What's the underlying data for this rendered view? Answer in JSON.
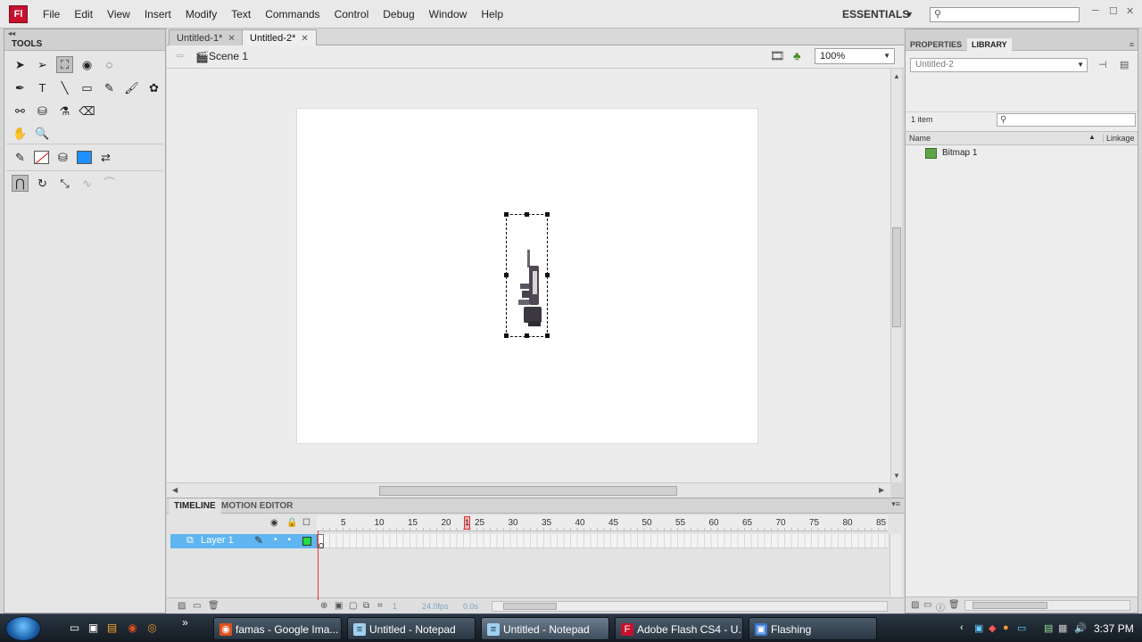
{
  "app": {
    "logo": "Fl",
    "menus": [
      "File",
      "Edit",
      "View",
      "Insert",
      "Modify",
      "Text",
      "Commands",
      "Control",
      "Debug",
      "Window",
      "Help"
    ],
    "workspace": "ESSENTIALS",
    "colors": {
      "logo_red": "#c8102e",
      "layer_blue": "#5fb5f0",
      "playhead_red": "#e33333",
      "fill_color": "#1e90ff",
      "layer_outline_green": "#22dd44"
    }
  },
  "tools_panel": {
    "title": "TOOLS",
    "icons": [
      "selection-icon",
      "subselection-icon",
      "free-transform-icon",
      "3d-rotation-icon",
      "lasso-icon",
      "pen-icon",
      "text-icon",
      "line-icon",
      "rectangle-icon",
      "pencil-icon",
      "brush-icon",
      "deco-icon",
      "bone-icon",
      "paint-bucket-icon",
      "eyedropper-icon",
      "eraser-icon",
      "hand-icon",
      "zoom-icon",
      "stroke-color-icon",
      "fill-color-icon",
      "swap-colors-icon",
      "snap-icon",
      "smooth-icon",
      "straighten-icon"
    ]
  },
  "document": {
    "tabs": [
      {
        "label": "Untitled-1*",
        "active": false
      },
      {
        "label": "Untitled-2*",
        "active": true
      }
    ],
    "scene": "Scene 1",
    "zoom": "100%"
  },
  "timeline": {
    "tabs": [
      "TIMELINE",
      "MOTION EDITOR"
    ],
    "frame_numbers": [
      "1",
      "5",
      "10",
      "15",
      "20",
      "25",
      "30",
      "35",
      "40",
      "45",
      "50",
      "55",
      "60",
      "65",
      "70",
      "75",
      "80",
      "85"
    ],
    "layer_name": "Layer 1",
    "current_frame": "1",
    "frame_rate": "24.0fps",
    "elapsed": "0.0s"
  },
  "right_panel": {
    "tabs": [
      "PROPERTIES",
      "LIBRARY"
    ],
    "active_tab": "LIBRARY",
    "document": "Untitled-2",
    "item_count": "1 item",
    "columns": {
      "name": "Name",
      "linkage": "Linkage"
    },
    "items": [
      {
        "name": "Bitmap 1",
        "type": "bitmap"
      }
    ]
  },
  "taskbar": {
    "buttons": [
      {
        "label": "famas - Google Ima...",
        "icon": "firefox-icon"
      },
      {
        "label": "Untitled - Notepad",
        "icon": "notepad-icon"
      },
      {
        "label": "Untitled - Notepad",
        "icon": "notepad-icon",
        "active": true
      },
      {
        "label": "Adobe Flash CS4 - U...",
        "icon": "flash-icon"
      },
      {
        "label": "Flashing",
        "icon": "window-icon"
      }
    ],
    "clock": "3:37 PM"
  }
}
